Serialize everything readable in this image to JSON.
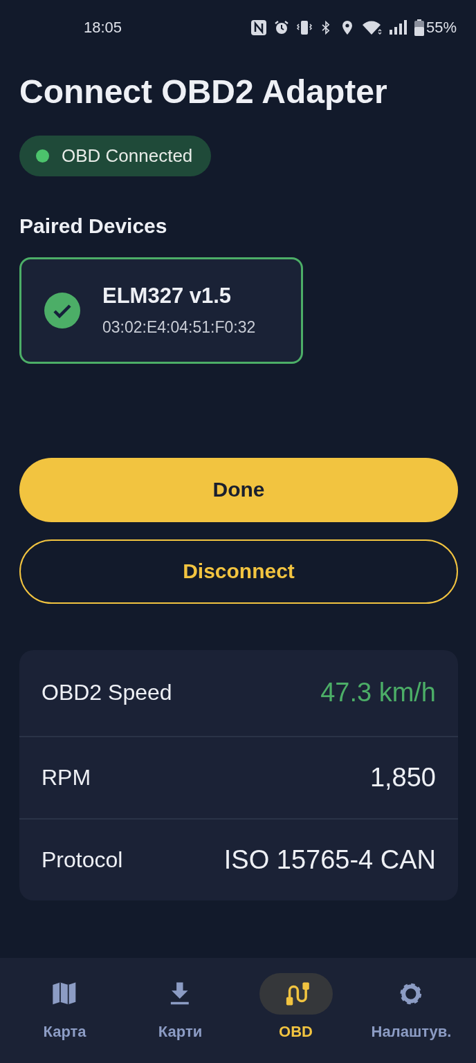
{
  "status_bar": {
    "time": "18:05",
    "battery": "55%"
  },
  "title": "Connect OBD2 Adapter",
  "connection_badge": {
    "label": "OBD Connected",
    "connected": true
  },
  "paired_devices": {
    "heading": "Paired Devices",
    "devices": [
      {
        "name": "ELM327 v1.5",
        "address": "03:02:E4:04:51:F0:32",
        "selected": true
      }
    ]
  },
  "buttons": [
    {
      "label": "Done",
      "kind": "filled"
    },
    {
      "label": "Disconnect",
      "kind": "outlined"
    }
  ],
  "stats": [
    {
      "label": "OBD2 Speed",
      "value": "47.3 km/h",
      "color": "#4cae67"
    },
    {
      "label": "RPM",
      "value": "1,850",
      "color": "#eef0f5"
    },
    {
      "label": "Protocol",
      "value": "ISO 15765-4 CAN",
      "color": "#eef0f5"
    }
  ],
  "nav": [
    {
      "label": "Карта",
      "selected": false
    },
    {
      "label": "Карти",
      "selected": false
    },
    {
      "label": "OBD",
      "selected": true
    },
    {
      "label": "Налаштув.",
      "selected": false
    }
  ]
}
